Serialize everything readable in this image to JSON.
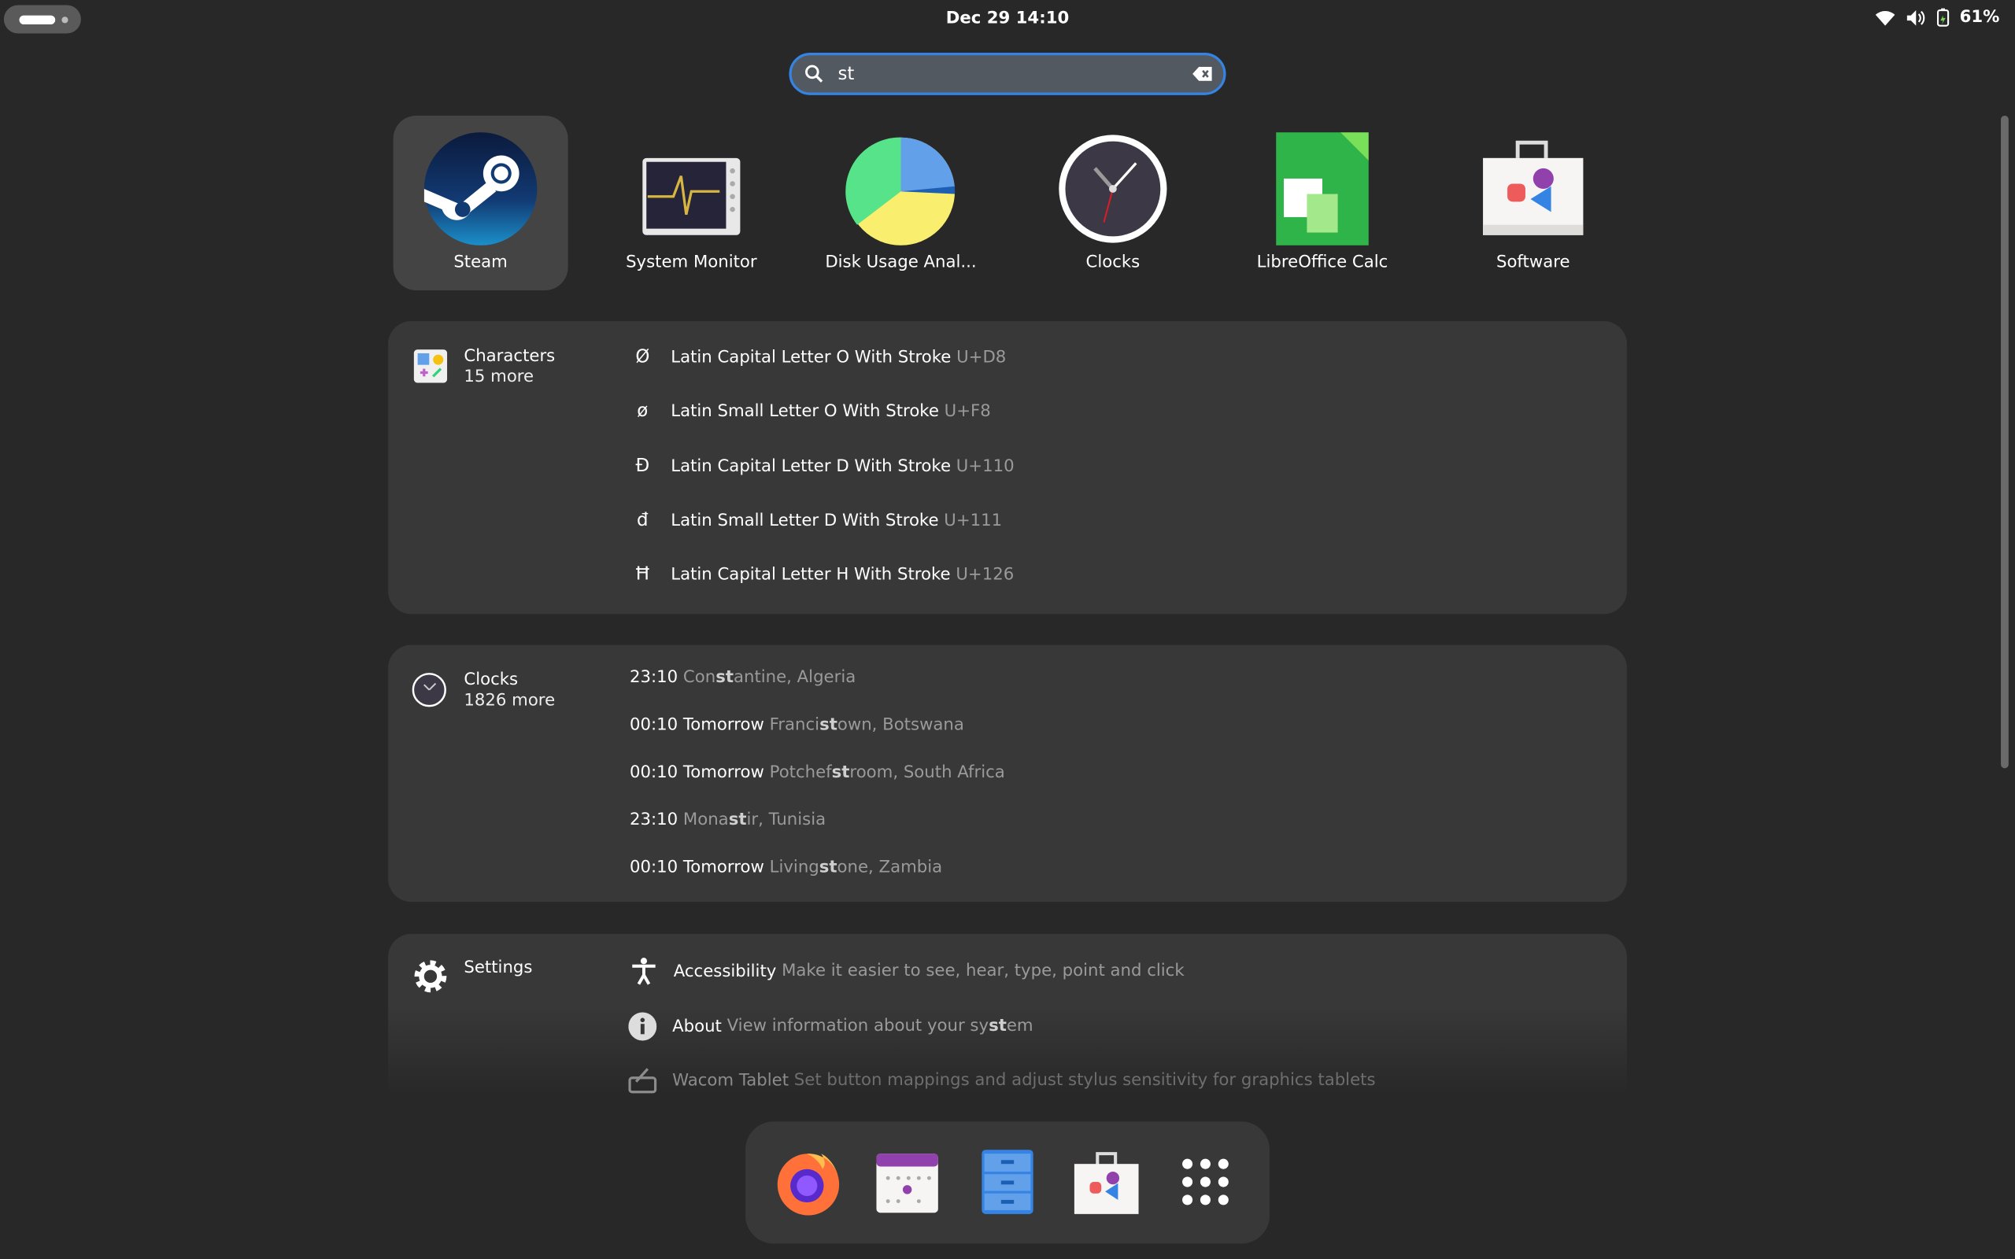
{
  "topbar": {
    "clock": "Dec 29  14:10",
    "battery_percent": "61%",
    "icons": [
      "wifi-icon",
      "volume-icon",
      "battery-icon"
    ]
  },
  "search": {
    "value": "st",
    "placeholder": ""
  },
  "apps": [
    {
      "label": "Steam",
      "icon": "steam-icon",
      "selected": true
    },
    {
      "label": "System Monitor",
      "icon": "system-monitor-icon"
    },
    {
      "label": "Disk Usage Anal...",
      "icon": "disk-usage-icon"
    },
    {
      "label": "Clocks",
      "icon": "clocks-icon"
    },
    {
      "label": "LibreOffice Calc",
      "icon": "libreoffice-calc-icon"
    },
    {
      "label": "Software",
      "icon": "software-icon"
    }
  ],
  "characters": {
    "title": "Characters",
    "more": "15 more",
    "items": [
      {
        "glyph": "Ø",
        "name": "Latin Capital Letter O With Stroke",
        "code": "U+D8"
      },
      {
        "glyph": "ø",
        "name": "Latin Small Letter O With Stroke",
        "code": "U+F8"
      },
      {
        "glyph": "Đ",
        "name": "Latin Capital Letter D With Stroke",
        "code": "U+110"
      },
      {
        "glyph": "đ",
        "name": "Latin Small Letter D With Stroke",
        "code": "U+111"
      },
      {
        "glyph": "Ħ",
        "name": "Latin Capital Letter H With Stroke",
        "code": "U+126"
      }
    ]
  },
  "clocks": {
    "title": "Clocks",
    "more": "1826 more",
    "items": [
      {
        "time": "23:10",
        "pre": "Con",
        "match": "st",
        "post": "antine, Algeria"
      },
      {
        "time": "00:10 Tomorrow",
        "pre": "Franci",
        "match": "st",
        "post": "own, Botswana"
      },
      {
        "time": "00:10 Tomorrow",
        "pre": "Potchef",
        "match": "st",
        "post": "room, South Africa"
      },
      {
        "time": "23:10",
        "pre": "Mona",
        "match": "st",
        "post": "ir, Tunisia"
      },
      {
        "time": "00:10 Tomorrow",
        "pre": "Living",
        "match": "st",
        "post": "one, Zambia"
      }
    ]
  },
  "settings": {
    "title": "Settings",
    "items": [
      {
        "name": "Accessibility",
        "desc": "Make it easier to see, hear, type, point and click",
        "icon": "accessibility-icon"
      },
      {
        "name": "About",
        "desc_pre": "View information about your sy",
        "desc_match": "st",
        "desc_post": "em",
        "icon": "info-icon"
      },
      {
        "name": "Wacom Tablet",
        "desc": "Set button mappings and adjust stylus sensitivity for graphics tablets",
        "icon": "wacom-tablet-icon"
      }
    ]
  },
  "dock": [
    "firefox-icon",
    "calendar-icon",
    "files-icon",
    "software-icon",
    "show-apps-icon"
  ],
  "colors": {
    "accent": "#3584e4",
    "background": "#282828",
    "card": "#383838"
  }
}
